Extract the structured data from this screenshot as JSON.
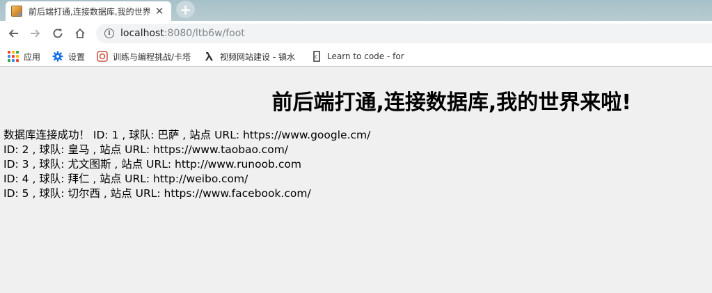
{
  "browser": {
    "tab_title": "前后端打通,连接数据库,我的世界",
    "tab_close": "✕",
    "new_tab": "+",
    "window_control": "...",
    "url_host": "localhost",
    "url_path": ":8080/ltb6w/foot"
  },
  "bookmarks": [
    {
      "label": "应用",
      "icon": "apps-grid-icon"
    },
    {
      "label": "设置",
      "icon": "gear-icon"
    },
    {
      "label": "训练与编程挑战/卡塔",
      "icon": "codewars-icon"
    },
    {
      "label": "视频网站建设 - 镇水",
      "icon": "lambda-icon"
    },
    {
      "label": "Learn to code - for",
      "icon": "freecodecamp-icon"
    }
  ],
  "page": {
    "heading": "前后端打通,连接数据库,我的世界来啦!",
    "rows": [
      "数据库连接成功！ ID: 1 , 球队: 巴萨 , 站点 URL: https://www.google.cm/",
      "ID: 2 , 球队: 皇马 , 站点 URL: https://www.taobao.com/",
      "ID: 3 , 球队: 尤文图斯 , 站点 URL: http://www.runoob.com",
      "ID: 4 , 球队: 拜仁 , 站点 URL: http://weibo.com/",
      "ID: 5 , 球队: 切尔西 , 站点 URL: https://www.facebook.com/"
    ]
  },
  "colors": {
    "tabstrip": "#a7c1c8",
    "page_background": "#f0f0f0",
    "gear": "#1a73e8",
    "codewars": "#c94a3a"
  }
}
